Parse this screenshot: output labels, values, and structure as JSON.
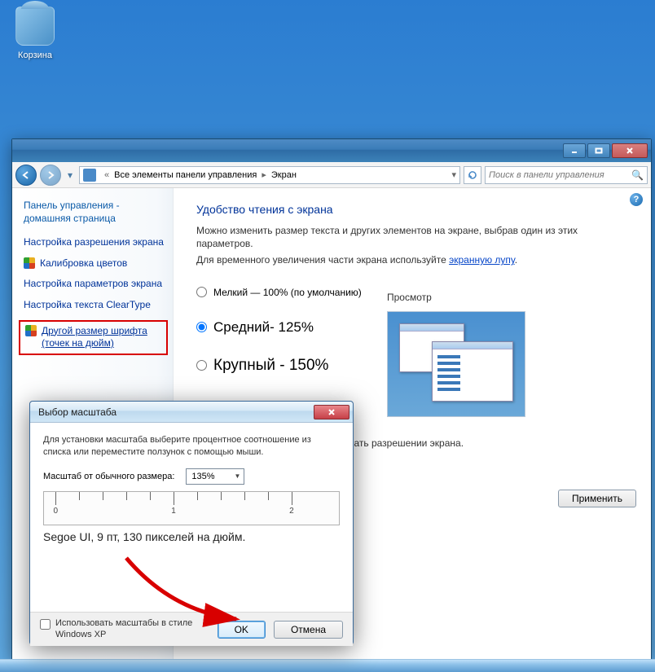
{
  "desktop": {
    "recycle_bin": "Корзина"
  },
  "window_controls": {
    "min": "_",
    "max": "□",
    "close": "×"
  },
  "nav": {
    "breadcrumb_root": "Все элементы панели управления",
    "breadcrumb_current": "Экран",
    "search_placeholder": "Поиск в панели управления"
  },
  "sidebar": {
    "home": "Панель управления - домашняя страница",
    "links": [
      "Настройка разрешения экрана",
      "Калибровка цветов",
      "Настройка параметров экрана",
      "Настройка текста ClearType",
      "Другой размер шрифта (точек на дюйм)"
    ]
  },
  "main": {
    "heading": "Удобство чтения с экрана",
    "desc1": "Можно изменить размер текста и других элементов на экране, выбрав один из этих параметров.",
    "desc2_a": "Для временного увеличения части экрана используйте ",
    "desc2_link": "экранную лупу",
    "opt_small": "Мелкий — 100% (по умолчанию)",
    "opt_medium": "Средний- 125%",
    "opt_large": "Крупный - 150%",
    "preview": "Просмотр",
    "note": "поместиться на экране, если выбрать разрешении экрана.",
    "apply": "Применить"
  },
  "dialog": {
    "title": "Выбор масштаба",
    "instr": "Для установки масштаба выберите процентное соотношение из списка или переместите ползунок с помощью мыши.",
    "scale_label": "Масштаб от обычного размера:",
    "scale_value": "135%",
    "ruler_labels": [
      "0",
      "1",
      "2"
    ],
    "sample": "Segoe UI, 9 пт, 130 пикселей на дюйм.",
    "xp_style": "Использовать масштабы в стиле Windows XP",
    "ok": "OK",
    "cancel": "Отмена"
  }
}
